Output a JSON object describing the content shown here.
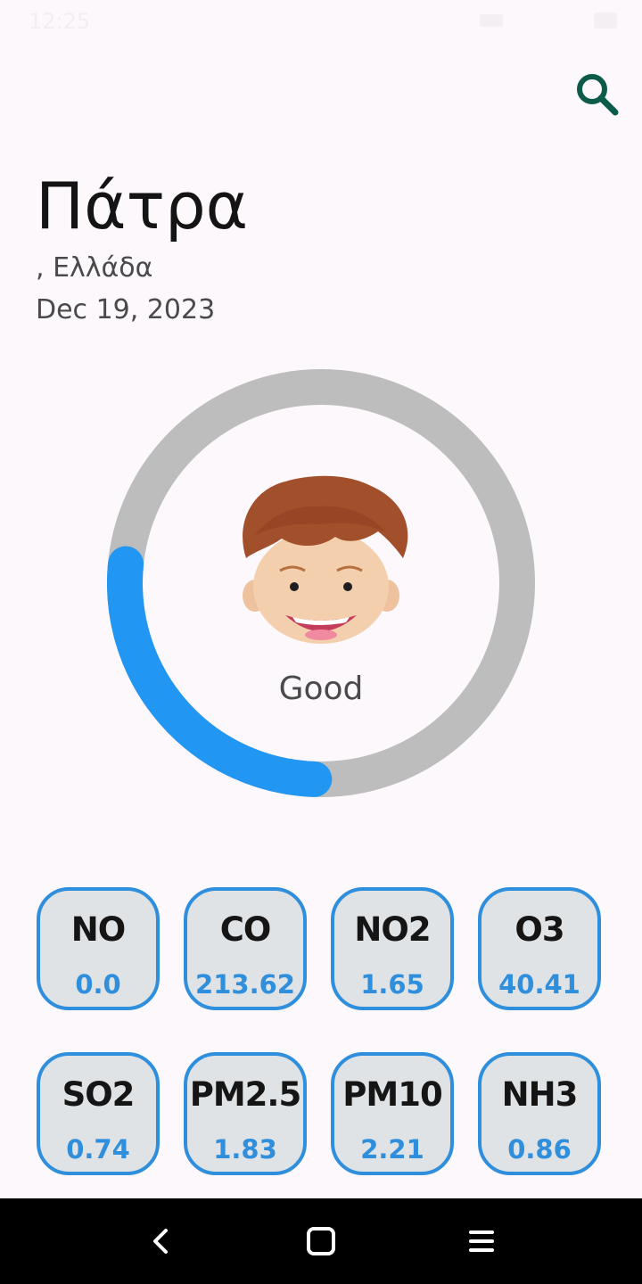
{
  "status_bar": {
    "time": "12:25"
  },
  "header": {
    "city": "Πάτρα",
    "country": ", Ελλάδα",
    "date": "Dec 19, 2023"
  },
  "aqi": {
    "status": "Good",
    "level_fraction": 0.26,
    "colors": {
      "track": "#bdbdbd",
      "progress": "#2196f3"
    }
  },
  "pollutants": [
    {
      "name": "NO",
      "value": "0.0"
    },
    {
      "name": "CO",
      "value": "213.62"
    },
    {
      "name": "NO2",
      "value": "1.65"
    },
    {
      "name": "O3",
      "value": "40.41"
    },
    {
      "name": "SO2",
      "value": "0.74"
    },
    {
      "name": "PM2.5",
      "value": "1.83"
    },
    {
      "name": "PM10",
      "value": "2.21"
    },
    {
      "name": "NH3",
      "value": "0.86"
    }
  ],
  "theme": {
    "accent": "#2f8fdc",
    "search_icon_color": "#0d5c4a",
    "card_background": "#dfe3e5"
  },
  "icons": {
    "search": "search-icon",
    "face": "happy-face-icon",
    "back": "back-icon",
    "home": "home-icon",
    "recents": "recents-icon"
  }
}
